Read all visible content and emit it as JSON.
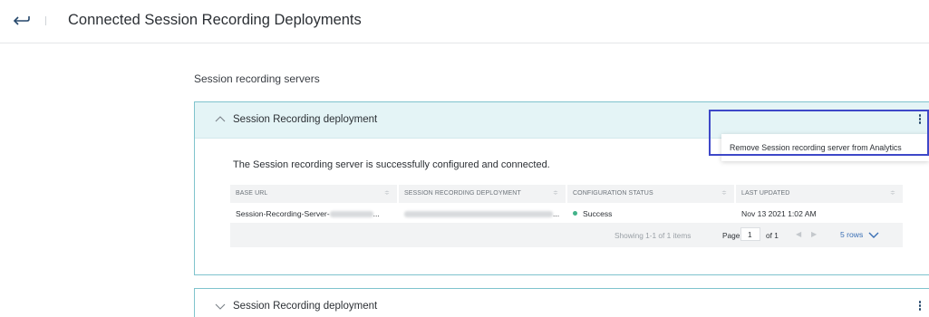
{
  "header": {
    "title": "Connected Session Recording Deployments",
    "back_icon": "back-arrow-icon"
  },
  "section": {
    "label": "Session recording servers"
  },
  "deployments": [
    {
      "title": "Session Recording deployment",
      "expanded": true,
      "status_message": "The Session recording server is successfully configured and connected.",
      "table": {
        "columns": [
          "BASE URL",
          "SESSION RECORDING DEPLOYMENT",
          "CONFIGURATION STATUS",
          "LAST UPDATED"
        ],
        "rows": [
          {
            "base_url": "Session-Recording-Server-",
            "base_url_suffix": "...",
            "deployment_suffix": "...",
            "status": "Success",
            "status_color": "#43b38a",
            "last_updated": "Nov 13 2021 1:02 AM"
          }
        ],
        "footer": {
          "showing": "Showing 1-1 of 1 items",
          "page_label": "Page",
          "page_value": "1",
          "of_label": "of 1",
          "rows_per_page": "5 rows"
        }
      }
    },
    {
      "title": "Session Recording deployment",
      "expanded": false
    }
  ],
  "context_menu": {
    "items": [
      "Remove Session recording server from Analytics"
    ]
  },
  "colors": {
    "accent_border": "#7fc3cd",
    "header_bg": "#e4f4f6",
    "highlight": "#3e48c8",
    "link": "#3a6fb5"
  }
}
